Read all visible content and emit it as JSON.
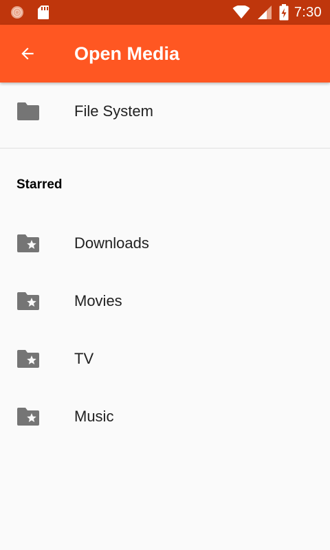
{
  "status_bar": {
    "time": "7:30",
    "icons": [
      "notification-icon",
      "sd-card-icon",
      "wifi-icon",
      "signal-icon",
      "battery-charging-icon"
    ]
  },
  "app_bar": {
    "title": "Open Media",
    "back_icon": "arrow-back-icon"
  },
  "colors": {
    "status_bar": "#bf360c",
    "app_bar": "#ff5722",
    "icon_gray": "#757575",
    "background": "#fafafa",
    "divider": "#e0e0e0"
  },
  "top_item": {
    "label": "File System",
    "icon": "folder-icon"
  },
  "starred": {
    "header": "Starred",
    "items": [
      {
        "label": "Downloads",
        "icon": "folder-star-icon"
      },
      {
        "label": "Movies",
        "icon": "folder-star-icon"
      },
      {
        "label": "TV",
        "icon": "folder-star-icon"
      },
      {
        "label": "Music",
        "icon": "folder-star-icon"
      }
    ]
  }
}
